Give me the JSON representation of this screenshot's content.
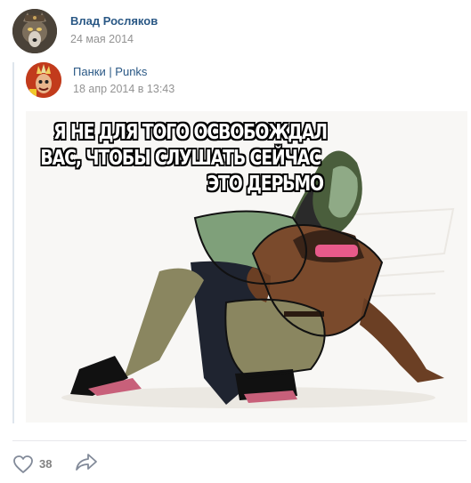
{
  "post": {
    "author": {
      "name": "Влад Росляков",
      "date": "24 мая 2014",
      "avatar_icon": "wolf-avatar"
    },
    "repost": {
      "source_name": "Панки | Punks",
      "date": "18 апр 2014 в 13:43",
      "avatar_icon": "punk-avatar",
      "image": {
        "caption_lines": [
          "Я НЕ ДЛЯ ТОГО ОСВОБОЖДАЛ",
          "ВАС, ЧТОБЫ СЛУШАТЬ СЕЙЧАС",
          "ЭТО ДЕРЬМО"
        ]
      }
    },
    "actions": {
      "likes": "38",
      "like_icon": "heart-icon",
      "share_icon": "share-arrow-icon"
    }
  },
  "colors": {
    "link": "#2a5885",
    "muted": "#939393",
    "border": "#dfe6ed"
  }
}
